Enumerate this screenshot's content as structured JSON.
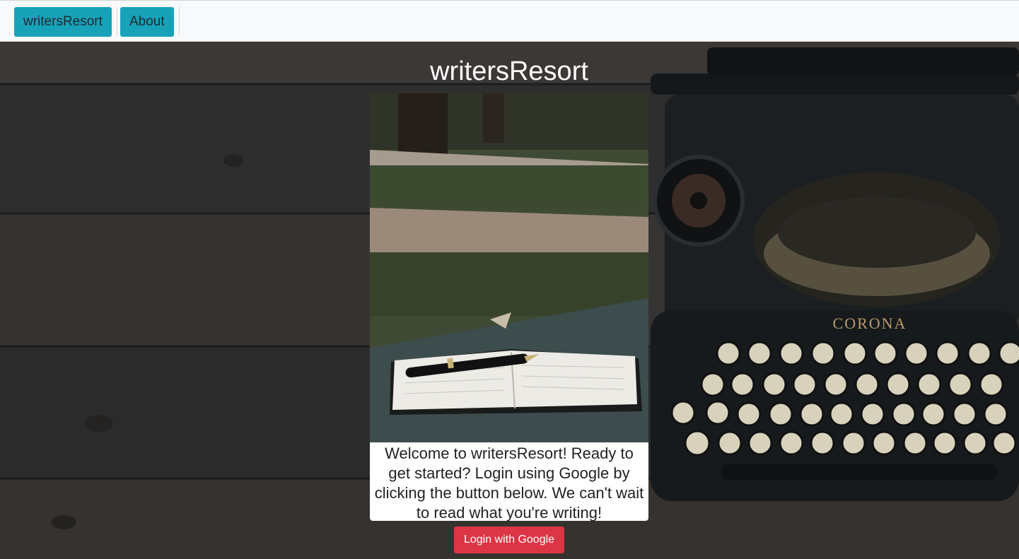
{
  "navbar": {
    "brand_label": "writersResort",
    "about_label": "About",
    "button_color": "#17a2b8"
  },
  "hero": {
    "title": "writersResort",
    "background_image": "wooden-planks-with-typewriter",
    "card_image": "notebook-and-pen-on-park-table",
    "welcome_text": "Welcome to writersResort! Ready to get started? Login using Google by clicking the button below. We can't wait to read what you're writing!",
    "login_label": "Login with Google",
    "login_color": "#dc3545",
    "typewriter_brand": "CORONA"
  }
}
